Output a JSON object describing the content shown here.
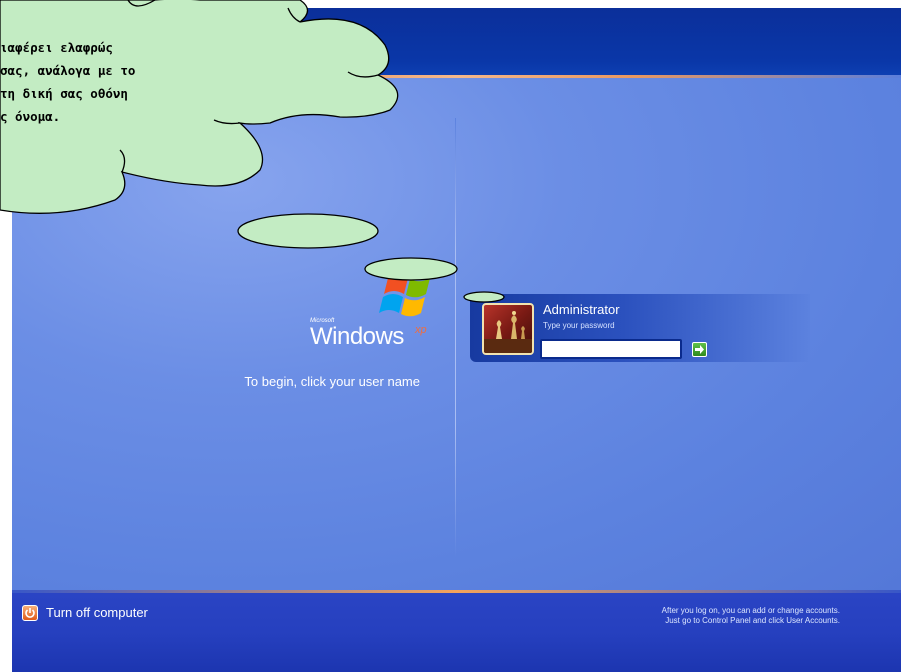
{
  "login": {
    "windows_brand": "Windows",
    "microsoft_brand": "Microsoft",
    "xp_brand": "xp",
    "begin_text": "To begin, click your user name",
    "user_name": "Administrator",
    "password_hint": "Type your password",
    "password_value": "",
    "turn_off_label": "Turn off computer",
    "accounts_line1": "After you log on, you can add or change accounts.",
    "accounts_line2": "Just go to Control Panel and click User Accounts."
  },
  "callout": {
    "line1": "ιαφέρει ελαφρώς",
    "line2": "σας, ανάλογα με το",
    "line3": "τη δική σας οθόνη",
    "line4": "ς όνομα."
  },
  "colors": {
    "top_bar": "#0a37a8",
    "main_bg": "#5c82df",
    "bottom_bar": "#2640bf",
    "callout_fill": "#c3ecc3",
    "go_button": "#3fa52a"
  },
  "icons": {
    "go": "arrow-right-icon",
    "power": "power-icon",
    "windows": "windows-flag-icon"
  }
}
